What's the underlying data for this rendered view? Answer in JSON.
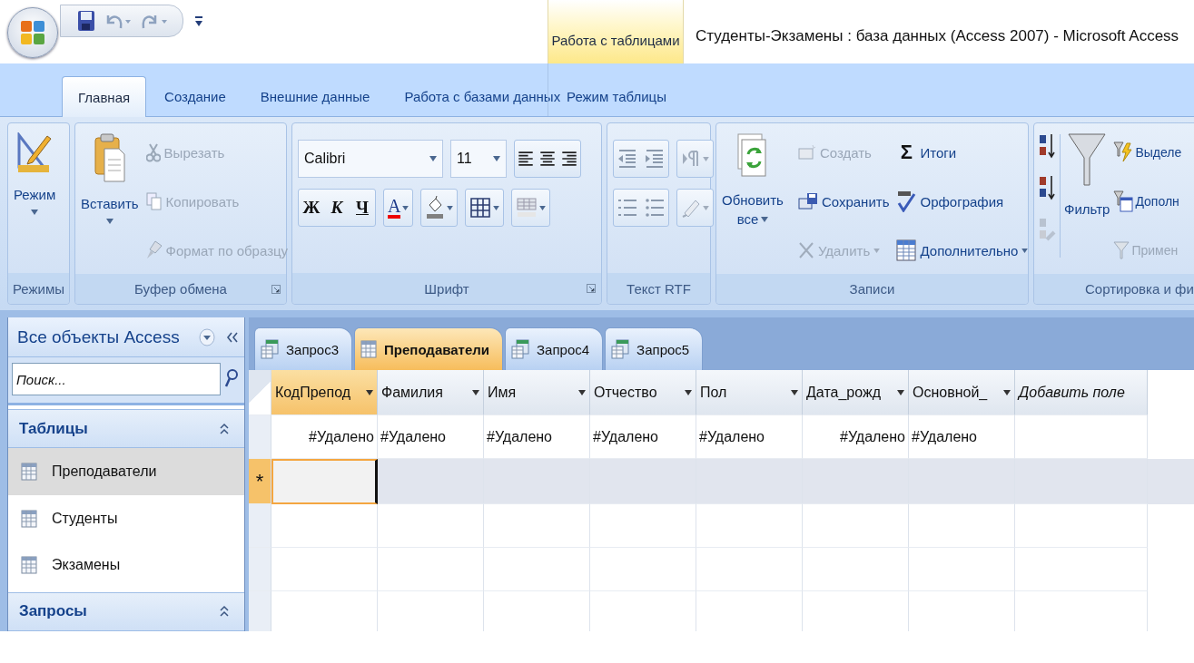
{
  "window": {
    "title": "Студенты-Экзамены : база данных (Access 2007) - Microsoft Access"
  },
  "contextual_tab_group": "Работа с таблицами",
  "ribbon_tabs": [
    {
      "label": "Главная",
      "selected": true,
      "contextual": false
    },
    {
      "label": "Создание",
      "selected": false,
      "contextual": false
    },
    {
      "label": "Внешние данные",
      "selected": false,
      "contextual": false
    },
    {
      "label": "Работа с базами данных",
      "selected": false,
      "contextual": false
    },
    {
      "label": "Режим таблицы",
      "selected": false,
      "contextual": true
    }
  ],
  "ribbon": {
    "views": {
      "label": "Режимы",
      "view_button": "Режим"
    },
    "clipboard": {
      "label": "Буфер обмена",
      "paste": "Вставить",
      "cut": {
        "label": "Вырезать",
        "disabled": true
      },
      "copy": {
        "label": "Копировать",
        "disabled": true
      },
      "format_painter": {
        "label": "Формат по образцу",
        "disabled": true
      }
    },
    "font": {
      "label": "Шрифт",
      "font_name": "Calibri",
      "font_size": "11",
      "bold": "Ж",
      "italic": "К",
      "underline": "Ч",
      "font_color": "А"
    },
    "rich_text": {
      "label": "Текст RTF"
    },
    "records": {
      "label": "Записи",
      "refresh": "Обновить",
      "refresh_line2": "все",
      "new": {
        "label": "Создать",
        "disabled": true
      },
      "save": {
        "label": "Сохранить",
        "disabled": false
      },
      "delete": {
        "label": "Удалить",
        "disabled": true
      },
      "totals_symbol": "Σ",
      "totals": {
        "label": "Итоги",
        "disabled": false
      },
      "spelling": {
        "label": "Орфография",
        "disabled": false
      },
      "more": {
        "label": "Дополнительно",
        "disabled": false
      }
    },
    "sort_filter": {
      "label": "Сортировка и фи",
      "filter": "Фильтр",
      "selection": {
        "label": "Выделе",
        "disabled": false
      },
      "advanced": {
        "label": "Дополн",
        "disabled": false
      },
      "apply": {
        "label": "Примен",
        "disabled": true
      }
    }
  },
  "navigation": {
    "title": "Все объекты Access",
    "search": {
      "placeholder": "Поиск..."
    },
    "groups": [
      {
        "label": "Таблицы",
        "items": [
          {
            "label": "Преподаватели",
            "selected": true
          },
          {
            "label": "Студенты",
            "selected": false
          },
          {
            "label": "Экзамены",
            "selected": false
          }
        ]
      },
      {
        "label": "Запросы"
      }
    ]
  },
  "document_tabs": [
    {
      "label": "Запрос3",
      "kind": "query",
      "selected": false
    },
    {
      "label": "Преподаватели",
      "kind": "table",
      "selected": true
    },
    {
      "label": "Запрос4",
      "kind": "query",
      "selected": false
    },
    {
      "label": "Запрос5",
      "kind": "query",
      "selected": false
    }
  ],
  "datasheet": {
    "columns": [
      {
        "label": "КодПрепод",
        "kind": "field",
        "numeric": true,
        "selected": true
      },
      {
        "label": "Фамилия",
        "kind": "field",
        "numeric": false,
        "selected": false
      },
      {
        "label": "Имя",
        "kind": "field",
        "numeric": false,
        "selected": false
      },
      {
        "label": "Отчество",
        "kind": "field",
        "numeric": false,
        "selected": false
      },
      {
        "label": "Пол",
        "kind": "field",
        "numeric": false,
        "selected": false
      },
      {
        "label": "Дата_рожд",
        "kind": "field",
        "numeric": true,
        "selected": false
      },
      {
        "label": "Основной_",
        "kind": "field",
        "numeric": false,
        "selected": false
      },
      {
        "label": "Добавить поле",
        "kind": "add",
        "selected": false
      }
    ],
    "rows": [
      {
        "cells": [
          "#Удалено",
          "#Удалено",
          "#Удалено",
          "#Удалено",
          "#Удалено",
          "#Удалено",
          "#Удалено",
          ""
        ]
      }
    ],
    "new_record_marker": "*"
  }
}
